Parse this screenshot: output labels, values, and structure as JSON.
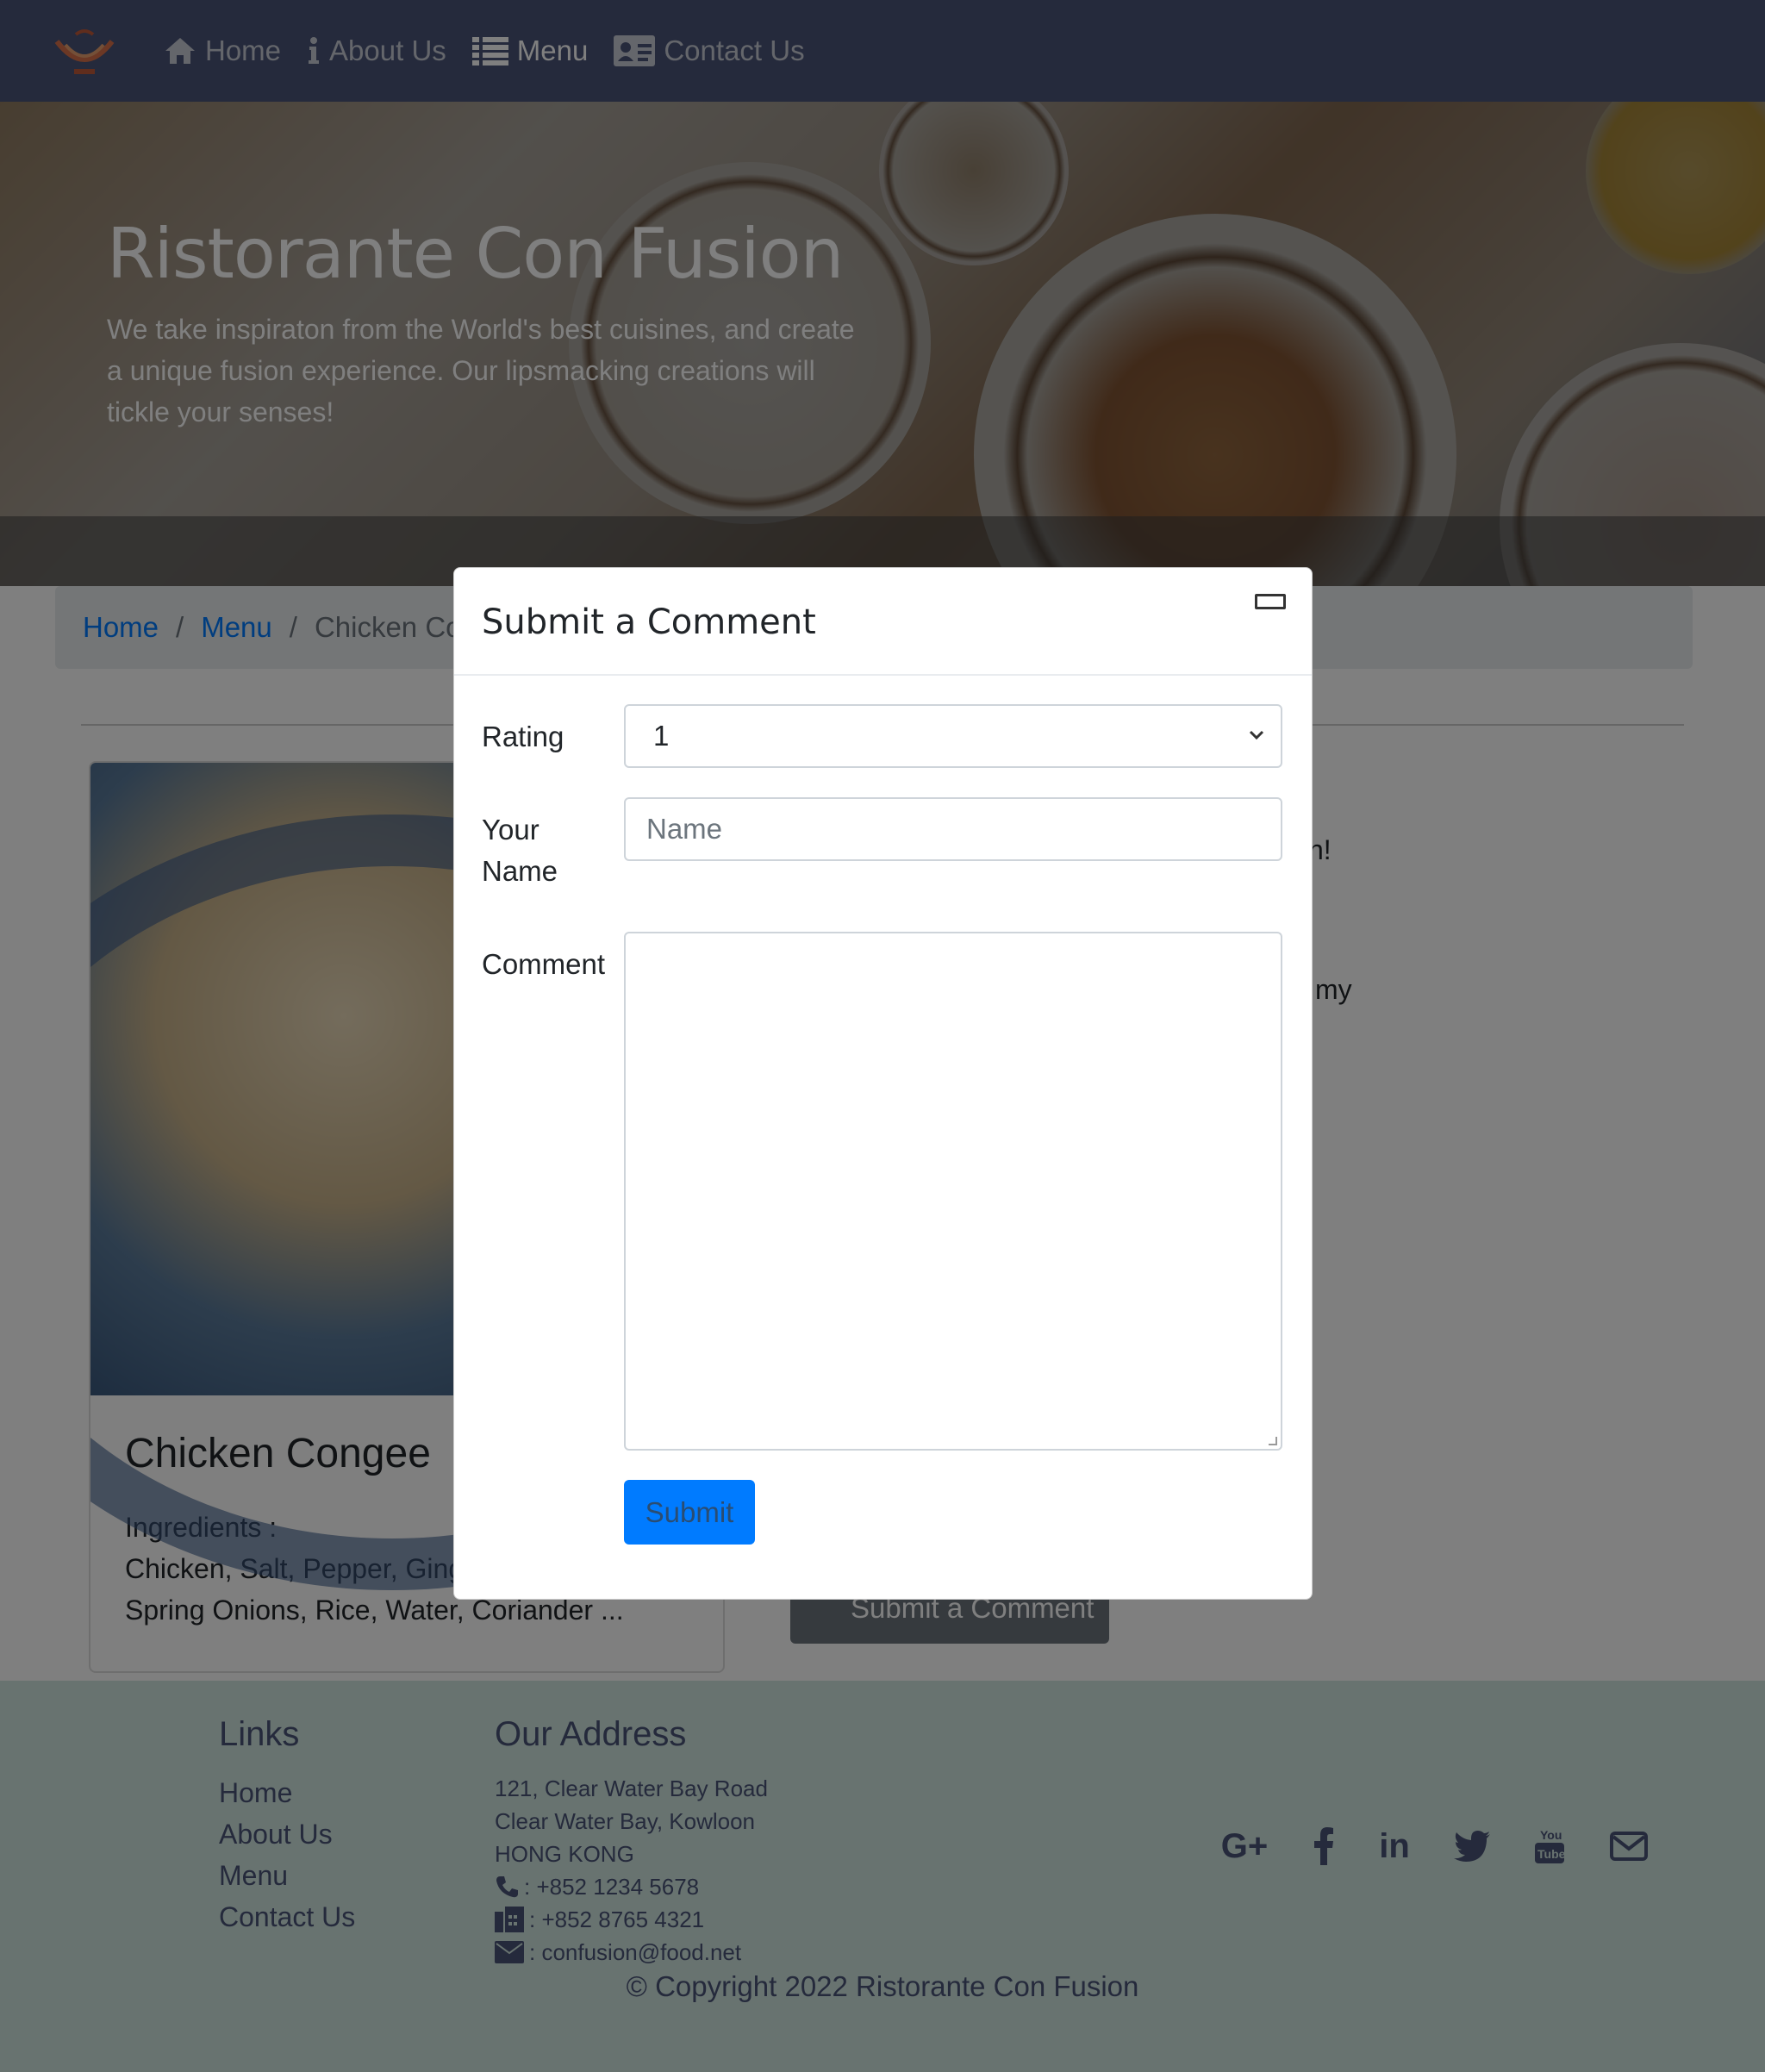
{
  "navbar": {
    "items": [
      {
        "label": "Home",
        "icon": "home-icon"
      },
      {
        "label": "About Us",
        "icon": "info-icon"
      },
      {
        "label": "Menu",
        "icon": "list-icon",
        "active": true
      },
      {
        "label": "Contact Us",
        "icon": "address-card-icon"
      }
    ]
  },
  "jumbotron": {
    "title": "Ristorante Con Fusion",
    "text": "We take inspiraton from the World's best cuisines, and create a unique fusion experience. Our lipsmacking creations will tickle your senses!"
  },
  "breadcrumb": {
    "items": [
      "Home",
      "Menu"
    ],
    "active": "Chicken Congee"
  },
  "dish": {
    "name": "Chicken Congee",
    "description_line1": "Ingredients :",
    "description_line2": "Chicken, Salt, Pepper, Ginger,",
    "description_line3": "Spring Onions, Rice, Water, Coriander ..."
  },
  "comments_partial": {
    "fragment1": "n!",
    "fragment2": "my"
  },
  "comment_button_label": "Submit a Comment",
  "modal": {
    "title": "Submit a Comment",
    "rating_label": "Rating",
    "rating_value": "1",
    "name_label_line1": "Your",
    "name_label_line2": "Name",
    "name_placeholder": "Name",
    "comment_label": "Comment",
    "submit_label": "Submit"
  },
  "footer": {
    "links_title": "Links",
    "links": [
      "Home",
      "About Us",
      "Menu",
      "Contact Us"
    ],
    "address_title": "Our Address",
    "address": [
      "121, Clear Water Bay Road",
      "Clear Water Bay, Kowloon",
      "HONG KONG"
    ],
    "phone": ": +852 1234 5678",
    "fax": ": +852 8765 4321",
    "email": ": confusion@food.net",
    "social": [
      "google-plus-icon",
      "facebook-icon",
      "linkedin-icon",
      "twitter-icon",
      "youtube-icon",
      "mail-icon"
    ],
    "copyright": "© Copyright 2022 Ristorante Con Fusion"
  },
  "colors": {
    "navbar": "#4a5478",
    "footer": "#d1e7e0",
    "primary": "#007bff"
  }
}
